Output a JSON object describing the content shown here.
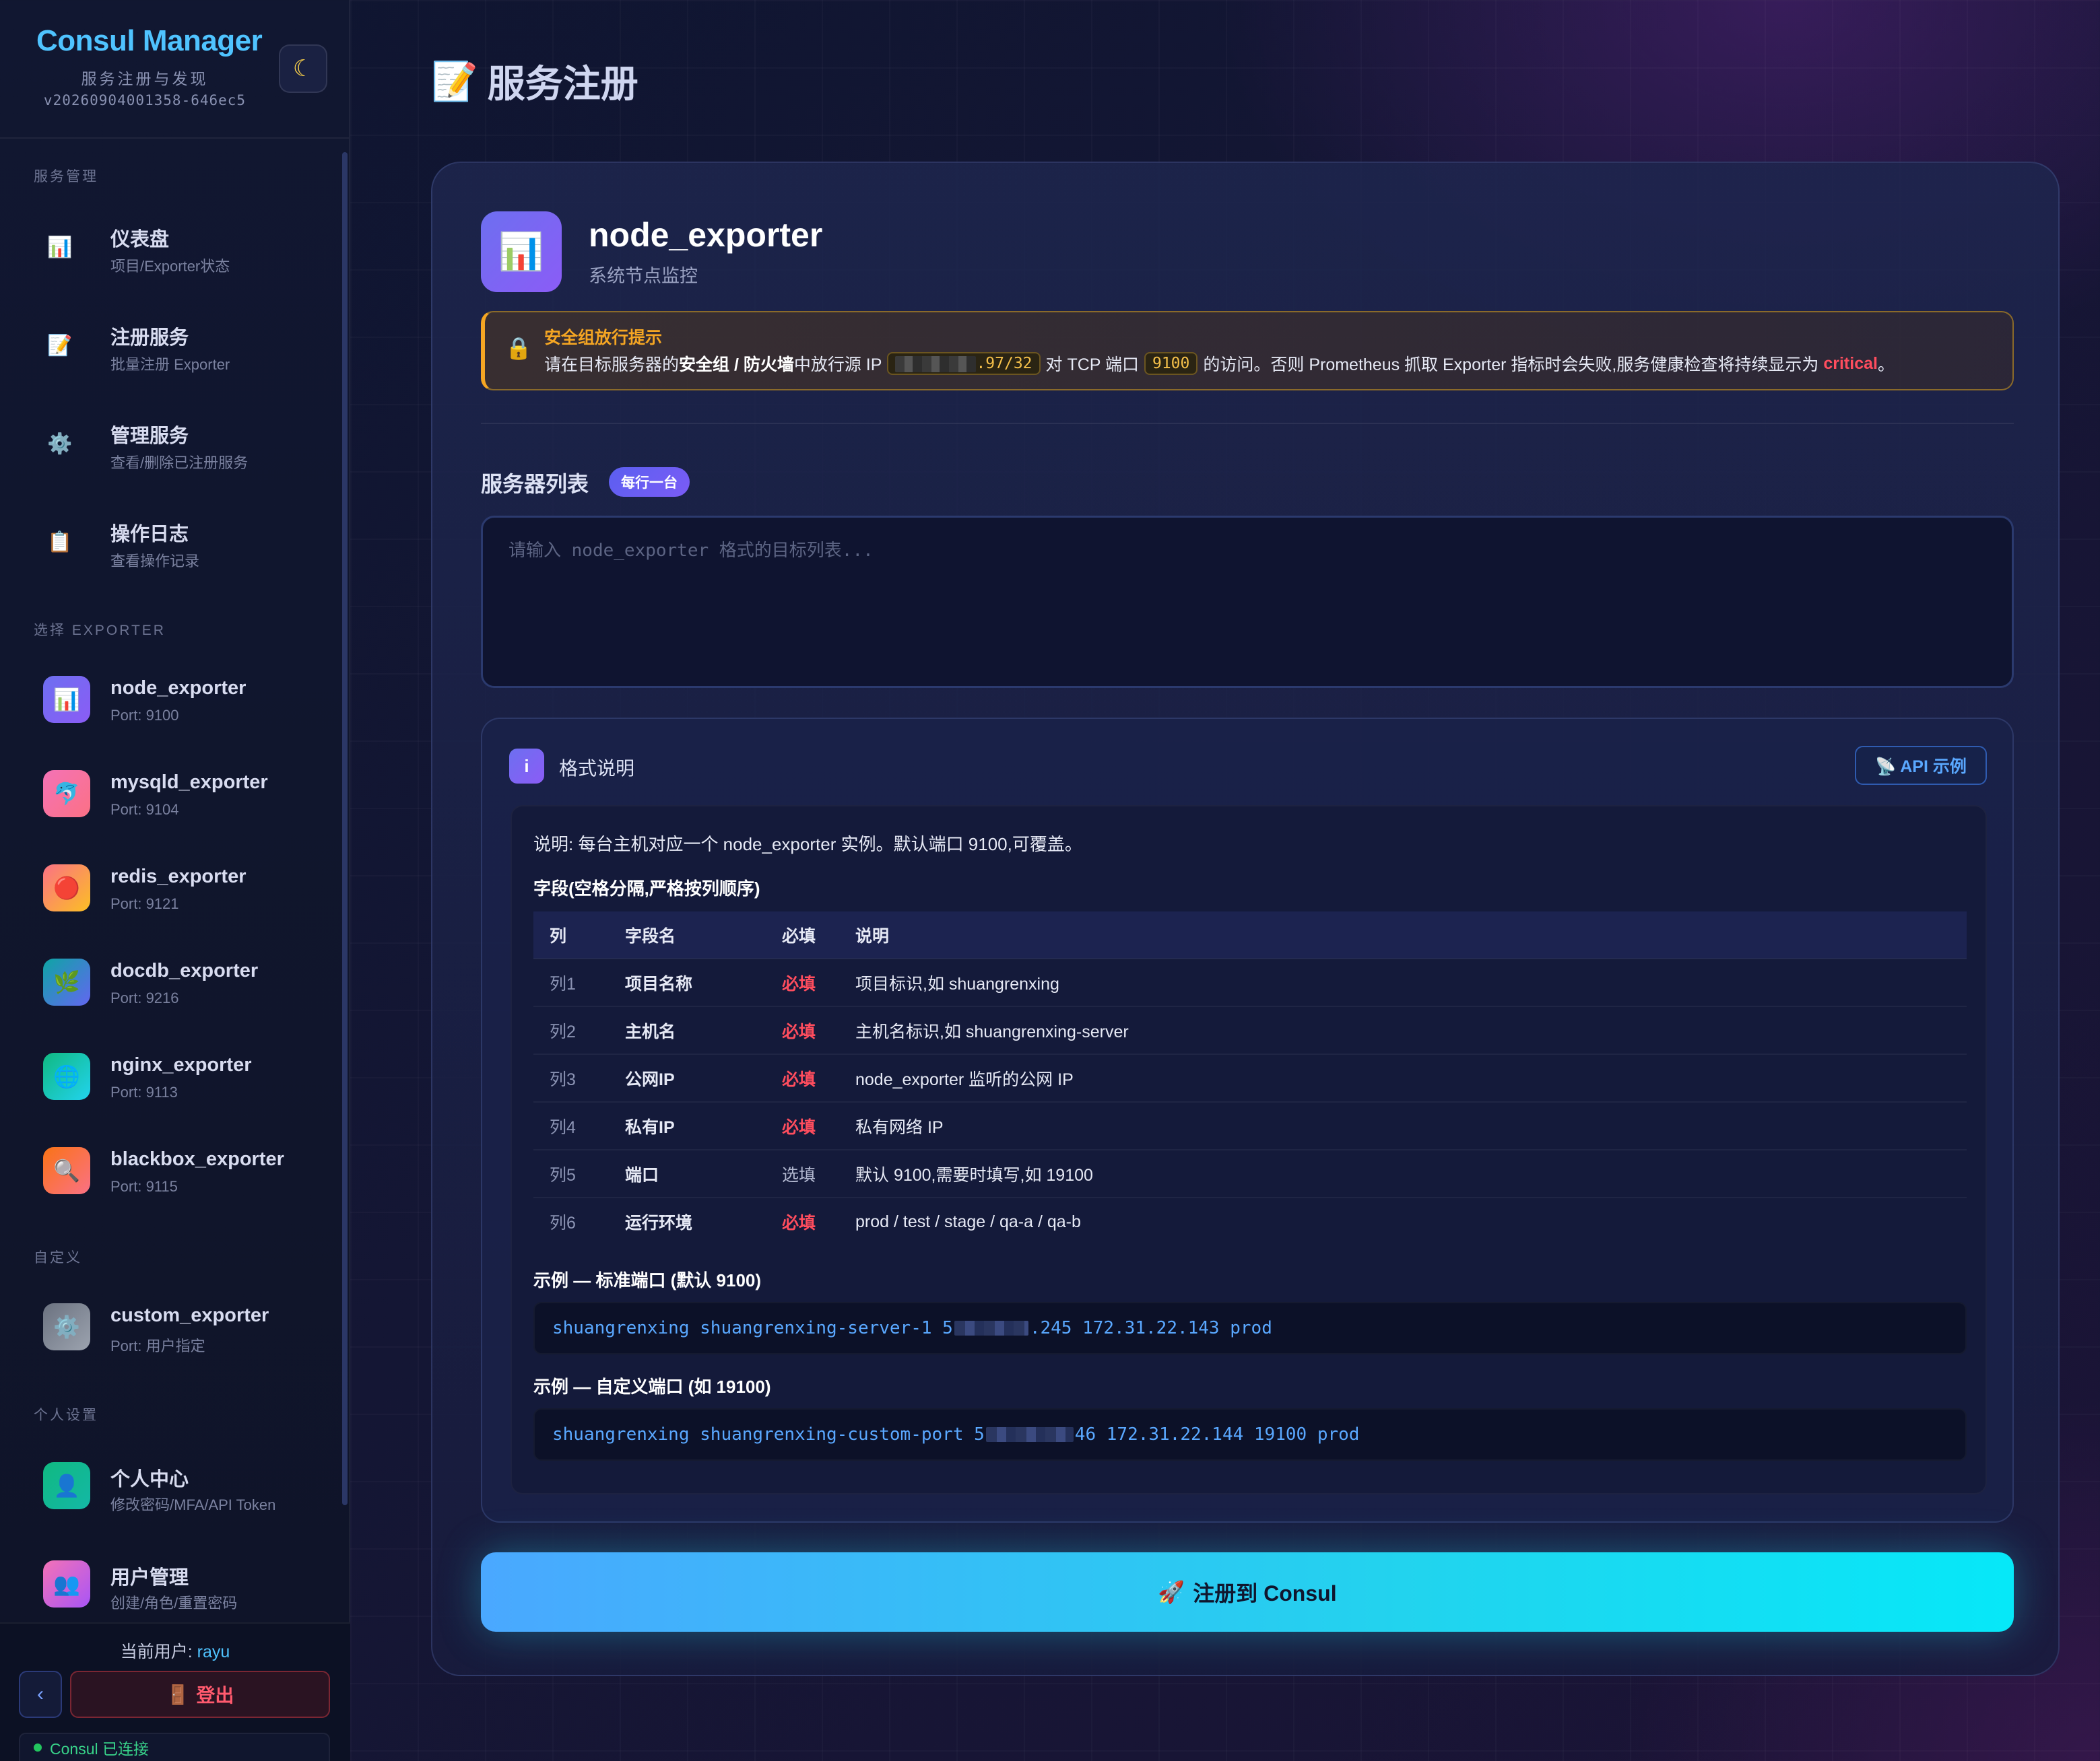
{
  "sidebar": {
    "brand_title": "Consul Manager",
    "brand_subtitle": "服务注册与发现",
    "version": "v20260904001358-646ec5",
    "theme_icon": "moon-icon",
    "sections": {
      "service_mgmt": "服务管理",
      "select_exporter": "选择 EXPORTER",
      "custom": "自定义",
      "personal": "个人设置"
    },
    "nav": [
      {
        "icon": "📊",
        "label": "仪表盘",
        "sub": "项目/Exporter状态"
      },
      {
        "icon": "📝",
        "label": "注册服务",
        "sub": "批量注册 Exporter"
      },
      {
        "icon": "⚙️",
        "label": "管理服务",
        "sub": "查看/删除已注册服务"
      },
      {
        "icon": "📋",
        "label": "操作日志",
        "sub": "查看操作记录"
      }
    ],
    "exporters": [
      {
        "icon": "📊",
        "name": "node_exporter",
        "port": "Port: 9100",
        "color": "#6d6ff0"
      },
      {
        "icon": "🐬",
        "name": "mysqld_exporter",
        "port": "Port: 9104",
        "color": "#f472b6"
      },
      {
        "icon": "🔴",
        "name": "redis_exporter",
        "port": "Port: 9121",
        "color": "#fb7185"
      },
      {
        "icon": "🌿",
        "name": "docdb_exporter",
        "port": "Port: 9216",
        "color": "#0ea5a4"
      },
      {
        "icon": "🌐",
        "name": "nginx_exporter",
        "port": "Port: 9113",
        "color": "#10b981"
      },
      {
        "icon": "🔍",
        "name": "blackbox_exporter",
        "port": "Port: 9115",
        "color": "#f97316"
      }
    ],
    "custom_exporter": {
      "icon": "⚙️",
      "name": "custom_exporter",
      "port": "Port: 用户指定",
      "color": "#6b7280"
    },
    "personal": [
      {
        "icon": "👤",
        "label": "个人中心",
        "sub": "修改密码/MFA/API Token",
        "color": "#10b981"
      },
      {
        "icon": "👥",
        "label": "用户管理",
        "sub": "创建/角色/重置密码",
        "color": "#f472b6"
      }
    ],
    "current_user_label": "当前用户: ",
    "current_user": "rayu",
    "collapse_icon": "‹",
    "logout_icon": "🚪",
    "logout": "登出",
    "connection": "Consul 已连接"
  },
  "main": {
    "page_title_icon": "📝",
    "page_title": "服务注册",
    "exporter": {
      "icon": "📊",
      "name": "node_exporter",
      "desc": "系统节点监控"
    },
    "alert": {
      "title": "安全组放行提示",
      "text_1": "请在目标服务器的",
      "text_bold": "安全组 / 防火墙",
      "text_2": "中放行源 IP",
      "ip_visible": ".97/32",
      "text_3": "对 TCP 端口",
      "port": "9100",
      "text_4": "的访问。否则 Prometheus 抓取 Exporter 指标时会失败,服务健康检查将持续显示为",
      "critical": "critical",
      "text_end": "。"
    },
    "server_list_title": "服务器列表",
    "server_list_badge": "每行一台",
    "textarea_placeholder": "请输入 node_exporter 格式的目标列表...",
    "format": {
      "icon": "i",
      "title": "格式说明",
      "api_button": "📡 API 示例",
      "description": "说明: 每台主机对应一个 node_exporter 实例。默认端口 9100,可覆盖。",
      "fields_title": "字段(空格分隔,严格按列顺序)",
      "headers": [
        "列",
        "字段名",
        "必填",
        "说明"
      ],
      "rows": [
        {
          "col": "列1",
          "name": "项目名称",
          "req": "必填",
          "req_type": "must",
          "desc": "项目标识,如 shuangrenxing"
        },
        {
          "col": "列2",
          "name": "主机名",
          "req": "必填",
          "req_type": "must",
          "desc": "主机名标识,如 shuangrenxing-server"
        },
        {
          "col": "列3",
          "name": "公网IP",
          "req": "必填",
          "req_type": "must",
          "desc": "node_exporter 监听的公网 IP"
        },
        {
          "col": "列4",
          "name": "私有IP",
          "req": "必填",
          "req_type": "must",
          "desc": "私有网络 IP"
        },
        {
          "col": "列5",
          "name": "端口",
          "req": "选填",
          "req_type": "opt",
          "desc": "默认 9100,需要时填写,如 19100"
        },
        {
          "col": "列6",
          "name": "运行环境",
          "req": "必填",
          "req_type": "must",
          "desc": "prod / test / stage / qa-a / qa-b"
        }
      ],
      "example1_title": "示例 — 标准端口 (默认 9100)",
      "example1_pre": "shuangrenxing shuangrenxing-server-1 5",
      "example1_post": ".245 172.31.22.143 prod",
      "example2_title": "示例 — 自定义端口 (如 19100)",
      "example2_pre": "shuangrenxing shuangrenxing-custom-port 5",
      "example2_post": "46 172.31.22.144 19100 prod"
    },
    "submit_icon": "🚀",
    "submit": "注册到 Consul"
  }
}
